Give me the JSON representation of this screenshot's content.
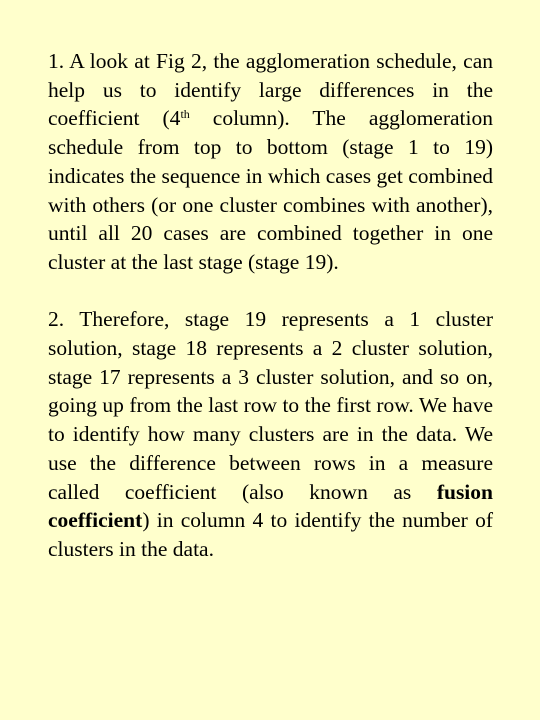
{
  "slide": {
    "background_color": "#FFFFCC",
    "text_color": "#000000",
    "paragraphs": [
      {
        "number": "1.",
        "part1": "A look at Fig 2, the agglomeration schedule, can help us to identify large differences in the coefficient (4",
        "sup": "th",
        "part2": " column). The agglomeration schedule from top to bottom (stage 1 to 19) indicates the sequence in which cases get combined with others (or one cluster combines with another), until all 20 cases are combined together in one cluster at the last stage (stage 19)."
      },
      {
        "number": "2.",
        "part1": "Therefore, stage 19 represents a 1 cluster solution, stage 18 represents a 2 cluster solution, stage 17 represents a 3 cluster solution, and so on, going up from the last row to the first row. We have to identify how many clusters are in the data. We use the difference between rows in a measure called coefficient (also known as ",
        "bold": "fusion coefficient",
        "part2": ") in column 4 to identify the number of clusters in the data."
      }
    ]
  }
}
